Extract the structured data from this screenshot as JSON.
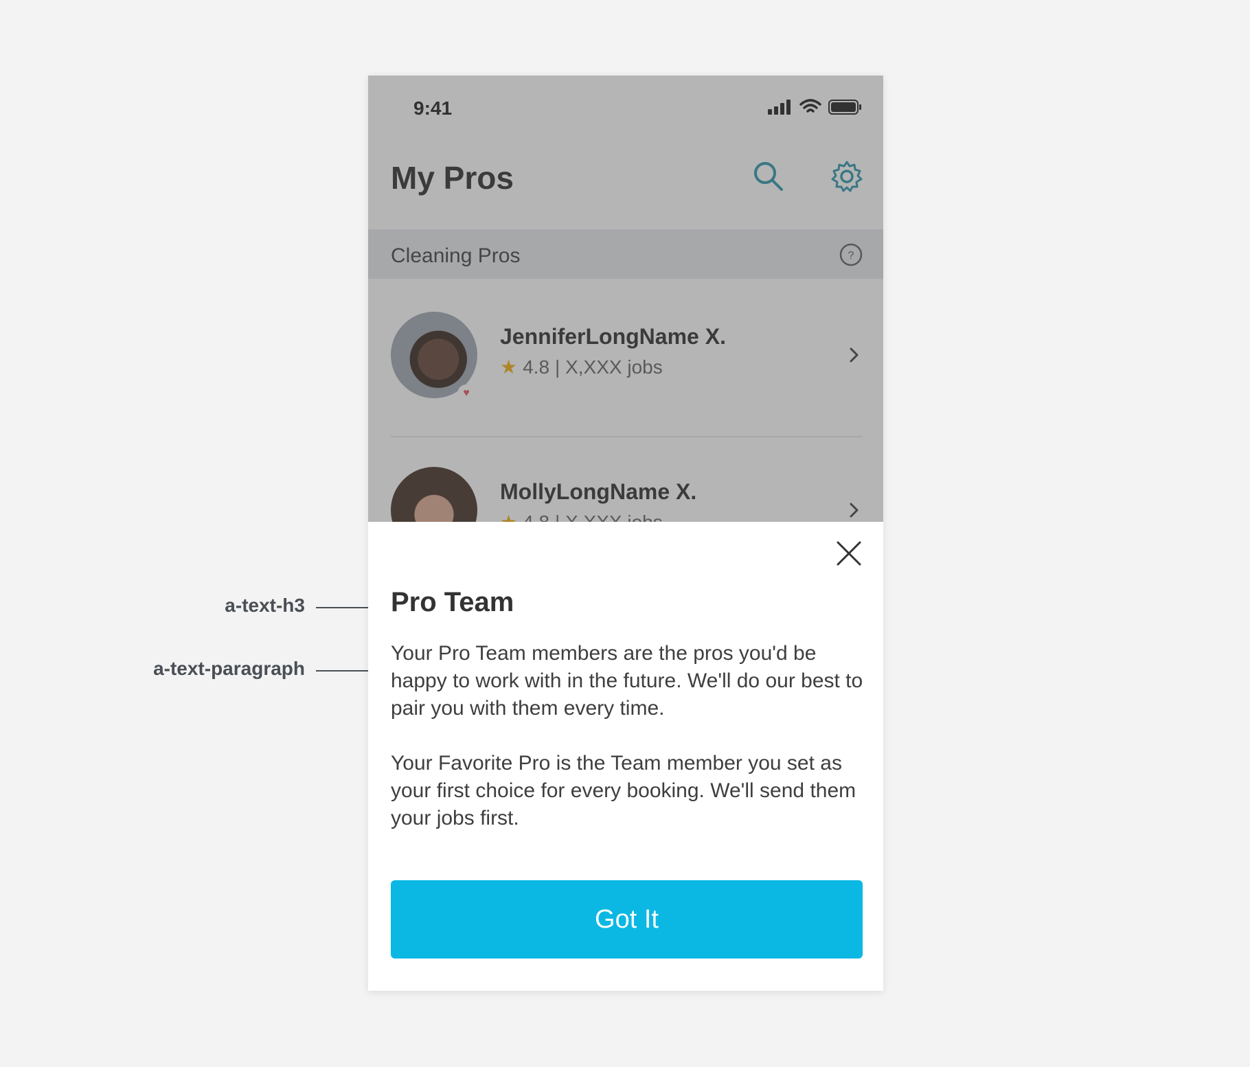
{
  "status_bar": {
    "time": "9:41"
  },
  "header": {
    "title": "My Pros"
  },
  "section": {
    "label": "Cleaning Pros"
  },
  "pros": [
    {
      "name": "JenniferLongName X.",
      "rating": "4.8",
      "jobs": "| X,XXX jobs",
      "favorite": true
    },
    {
      "name": "MollyLongName X.",
      "rating": "4.8",
      "jobs": "| X,XXX jobs",
      "favorite": false
    }
  ],
  "sheet": {
    "title": "Pro Team",
    "paragraph_1": "Your Pro Team members are the pros you'd be happy to work with in the future. We'll do our best to pair you with them every time.",
    "paragraph_2": "Your Favorite Pro is the Team member you set as your first choice for every booking. We'll send them your jobs first.",
    "button_label": "Got It"
  },
  "annotations": {
    "h3": "a-text-h3",
    "paragraph": "a-text-paragraph"
  },
  "colors": {
    "accent": "#0bb8e3",
    "icon_teal": "#1f8fa6",
    "star": "#f2a900",
    "heart": "#e0485e"
  },
  "icons": [
    "search-icon",
    "gear-icon",
    "help-icon",
    "chevron-right-icon",
    "close-icon",
    "star-icon",
    "heart-icon",
    "signal-icon",
    "wifi-icon",
    "battery-icon"
  ]
}
